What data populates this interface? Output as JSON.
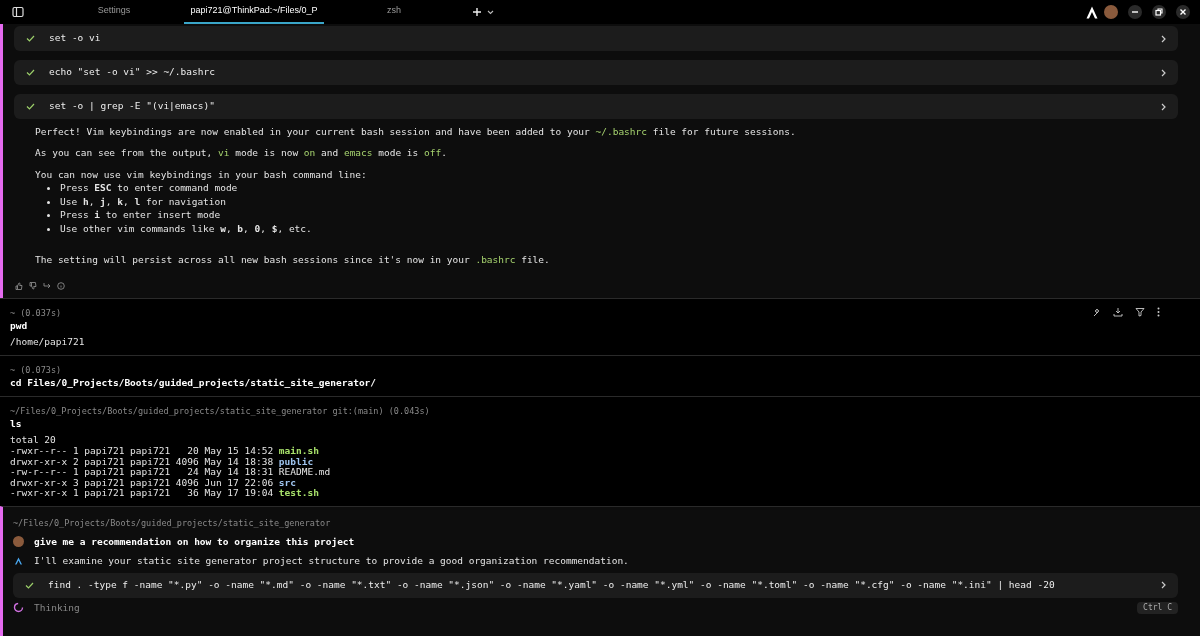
{
  "tabs": [
    {
      "label": "Settings",
      "selected": false
    },
    {
      "label": "papi721@ThinkPad:~/Files/0_P",
      "selected": true
    },
    {
      "label": "zsh",
      "selected": false
    }
  ],
  "agent_block_1": {
    "tool_calls": [
      {
        "command": "set -o vi",
        "completed": true
      },
      {
        "command": "echo \"set -o vi\" >> ~/.bashrc",
        "completed": true
      },
      {
        "command": "set -o | grep -E \"(vi|emacs)\"",
        "completed": true
      }
    ],
    "paragraphs": [
      [
        {
          "text": "Perfect! Vim keybindings are now enabled in your current bash session and have been added to your ",
          "kind": "plain"
        },
        {
          "text": "~/.bashrc",
          "kind": "code"
        },
        {
          "text": " file for future sessions.",
          "kind": "plain"
        }
      ],
      [
        {
          "text": "As you can see from the output, ",
          "kind": "plain"
        },
        {
          "text": "vi",
          "kind": "code"
        },
        {
          "text": " mode is now ",
          "kind": "plain"
        },
        {
          "text": "on",
          "kind": "code"
        },
        {
          "text": " and ",
          "kind": "plain"
        },
        {
          "text": "emacs",
          "kind": "code"
        },
        {
          "text": " mode is ",
          "kind": "plain"
        },
        {
          "text": "off",
          "kind": "code"
        },
        {
          "text": ".",
          "kind": "plain"
        }
      ],
      [
        {
          "text": "You can now use vim keybindings in your bash command line:",
          "kind": "plain"
        }
      ]
    ],
    "bullets": [
      "Press **ESC** to enter command mode",
      "Use **h**, **j**, **k**, **l** for navigation",
      "Press **i** to enter insert mode",
      "Use other vim commands like **w**, **b**, **0**, **$**, etc."
    ],
    "closing": [
      {
        "text": "The setting will persist across all new bash sessions since it's now in your ",
        "kind": "plain"
      },
      {
        "text": ".bashrc",
        "kind": "code"
      },
      {
        "text": " file.",
        "kind": "plain"
      }
    ]
  },
  "commands": [
    {
      "prompt": "~ (0.037s)",
      "command": "pwd",
      "output": [
        "/home/papi721"
      ],
      "toolbar": true
    },
    {
      "prompt": "~ (0.073s)",
      "command": "cd Files/0_Projects/Boots/guided_projects/static_site_generator/",
      "toolbar": false
    },
    {
      "prompt": "~/Files/0_Projects/Boots/guided_projects/static_site_generator git:(main) (0.043s)",
      "command": "ls",
      "output": [
        "total 20"
      ],
      "toolbar": false,
      "listing": [
        {
          "info": "-rwxr--r-- 1 papi721 papi721   20 May 15 14:52 ",
          "name": "main.sh",
          "kind": "exec"
        },
        {
          "info": "drwxr-xr-x 2 papi721 papi721 4096 May 14 18:38 ",
          "name": "public",
          "kind": "dir"
        },
        {
          "info": "-rw-r--r-- 1 papi721 papi721   24 May 14 18:31 ",
          "name": "README.md",
          "kind": "file"
        },
        {
          "info": "drwxr-xr-x 3 papi721 papi721 4096 Jun 17 22:06 ",
          "name": "src",
          "kind": "dir"
        },
        {
          "info": "-rwxr-xr-x 1 papi721 papi721   36 May 17 19:04 ",
          "name": "test.sh",
          "kind": "exec"
        }
      ]
    }
  ],
  "agent_block_2": {
    "path": "~/Files/0_Projects/Boots/guided_projects/static_site_generator",
    "user_prompt": "give me a recommendation on how to organize this project",
    "reply": "I'll examine your static site generator project structure to provide a good organization recommendation.",
    "tool_calls": [
      {
        "command": "find . -type f -name \"*.py\" -o -name \"*.md\" -o -name \"*.txt\" -o -name \"*.json\" -o -name \"*.yaml\" -o -name \"*.yml\" -o -name \"*.toml\" -o -name \"*.cfg\" -o -name \"*.ini\" | head -20",
        "completed": true
      }
    ],
    "status": "Thinking",
    "stop_hint": "Ctrl C"
  }
}
